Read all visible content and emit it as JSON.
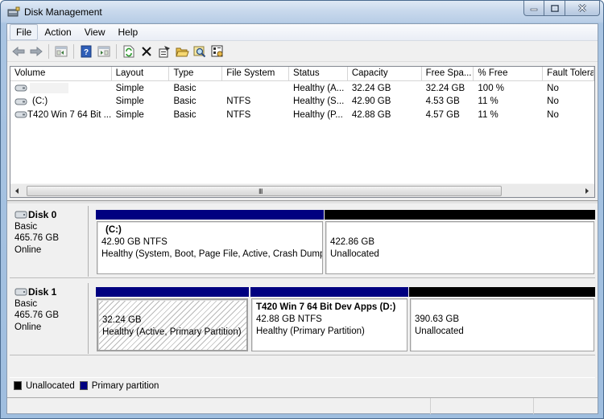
{
  "window": {
    "title": "Disk Management",
    "controls": {
      "minimize": "minimize",
      "maximize": "maximize",
      "close": "close"
    }
  },
  "menu": {
    "items": [
      "File",
      "Action",
      "View",
      "Help"
    ]
  },
  "toolbar": {
    "buttons": [
      {
        "icon": "back-arrow-icon",
        "label": "Back"
      },
      {
        "icon": "forward-arrow-icon",
        "label": "Forward"
      },
      {
        "icon": "show-hide-console-tree-icon",
        "label": "Show/Hide Console Tree"
      },
      {
        "icon": "help-icon",
        "label": "Help"
      },
      {
        "icon": "show-hide-action-pane-icon",
        "label": "Show/Hide Action Pane"
      },
      {
        "icon": "refresh-icon",
        "label": "Refresh"
      },
      {
        "icon": "delete-icon",
        "label": "Delete"
      },
      {
        "icon": "properties-icon",
        "label": "Properties"
      },
      {
        "icon": "open-folder-icon",
        "label": "Open"
      },
      {
        "icon": "explore-icon",
        "label": "Explore"
      },
      {
        "icon": "settings-icon",
        "label": "Settings"
      }
    ]
  },
  "volume_list": {
    "columns": [
      "Volume",
      "Layout",
      "Type",
      "File System",
      "Status",
      "Capacity",
      "Free Spa...",
      "% Free",
      "Fault Tolera"
    ],
    "rows": [
      {
        "volume": "",
        "layout": "Simple",
        "type": "Basic",
        "fs": "",
        "status": "Healthy (A...",
        "capacity": "32.24 GB",
        "free": "32.24 GB",
        "pct_free": "100 %",
        "fault": "No"
      },
      {
        "volume": "(C:)",
        "layout": "Simple",
        "type": "Basic",
        "fs": "NTFS",
        "status": "Healthy (S...",
        "capacity": "42.90 GB",
        "free": "4.53 GB",
        "pct_free": "11 %",
        "fault": "No"
      },
      {
        "volume": "T420 Win 7 64 Bit ...",
        "layout": "Simple",
        "type": "Basic",
        "fs": "NTFS",
        "status": "Healthy (P...",
        "capacity": "42.88 GB",
        "free": "4.57 GB",
        "pct_free": "11 %",
        "fault": "No"
      }
    ],
    "scroll_grip": "III"
  },
  "disks": [
    {
      "name": "Disk 0",
      "type": "Basic",
      "size": "465.76 GB",
      "status": "Online",
      "partitions": [
        {
          "kind": "primary",
          "title": "(C:)",
          "size_line": "42.90 GB NTFS",
          "status": "Healthy (System, Boot, Page File, Active, Crash Dump, Primary Partition)"
        },
        {
          "kind": "unallocated",
          "title": "",
          "size_line": "422.86 GB",
          "status": "Unallocated"
        }
      ]
    },
    {
      "name": "Disk 1",
      "type": "Basic",
      "size": "465.76 GB",
      "status": "Online",
      "partitions": [
        {
          "kind": "primary-selected",
          "title": "",
          "size_line": "32.24 GB",
          "status": "Healthy (Active, Primary Partition)"
        },
        {
          "kind": "primary",
          "title": "T420 Win 7 64 Bit Dev Apps  (D:)",
          "size_line": "42.88 GB NTFS",
          "status": "Healthy (Primary Partition)"
        },
        {
          "kind": "unallocated",
          "title": "",
          "size_line": "390.63 GB",
          "status": "Unallocated"
        }
      ]
    }
  ],
  "legend": {
    "items": [
      {
        "label": "Unallocated",
        "color": "#000000"
      },
      {
        "label": "Primary partition",
        "color": "#000080"
      }
    ]
  },
  "colors": {
    "primary_partition": "#000080",
    "unallocated": "#000000"
  }
}
